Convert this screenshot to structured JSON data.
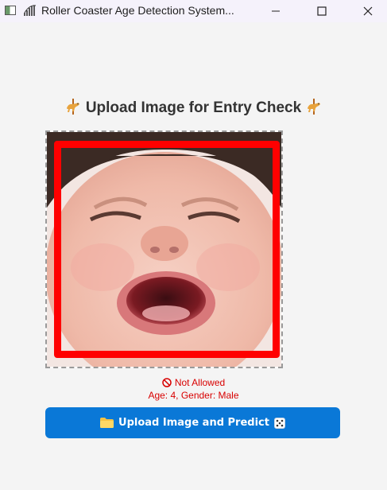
{
  "window": {
    "title": "Roller Coaster Age Detection System...",
    "minimize_icon": "minimize-icon",
    "maximize_icon": "maximize-icon",
    "close_icon": "close-icon"
  },
  "main": {
    "heading": "Upload Image for Entry Check",
    "heading_icon": "carousel-horse-icon",
    "photo_description_icon": "face-photo",
    "result": {
      "status": "Not Allowed",
      "status_icon": "prohibited-icon",
      "details": "Age: 4, Gender: Male",
      "color": "#d80000"
    },
    "upload_button": {
      "label": "Upload Image and Predict",
      "left_icon": "folder-icon",
      "right_icon": "dice-icon",
      "color": "#0a78d7"
    },
    "detection_box_color": "#ff0000"
  }
}
